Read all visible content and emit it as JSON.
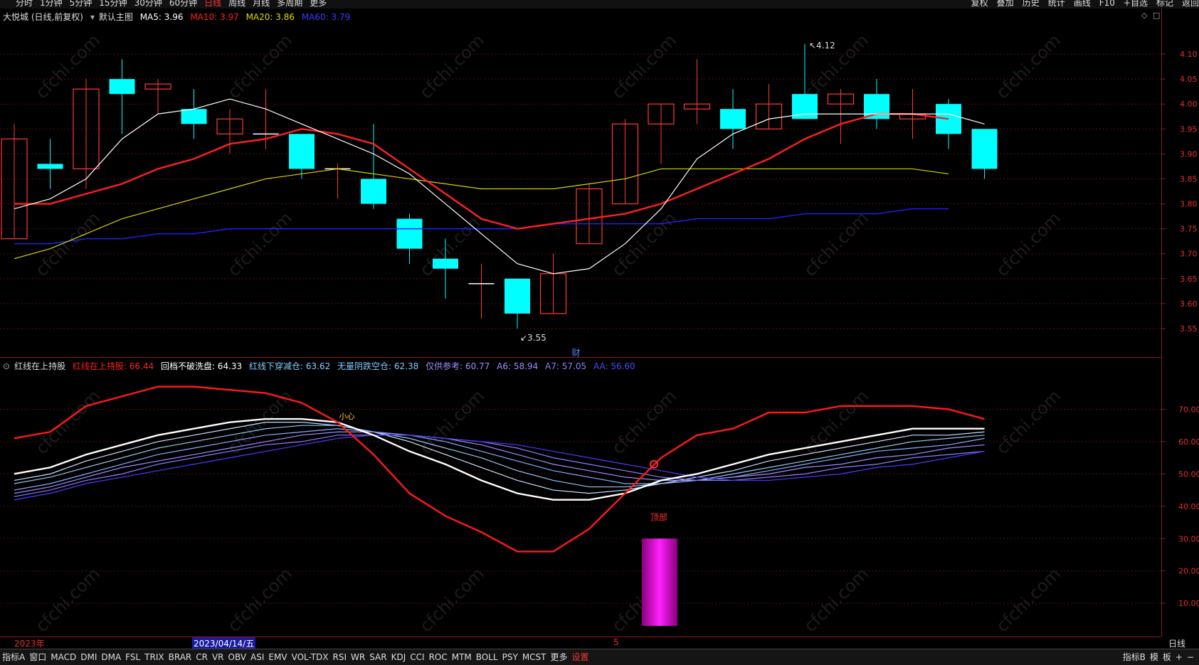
{
  "topbar": {
    "periods": [
      "分时",
      "1分钟",
      "5分钟",
      "15分钟",
      "30分钟",
      "60分钟",
      "日线",
      "周线",
      "月线",
      "多周期",
      "更多"
    ],
    "active_period": "日线",
    "right": [
      "复权",
      "叠加",
      "历史",
      "统计",
      "画线",
      "F10",
      "+自选",
      "标记",
      "返回"
    ]
  },
  "main": {
    "title": "大悦城 (日线,前复权)",
    "template": "默认主图",
    "ma5": "MA5: 3.96",
    "ma10": "MA10: 3.97",
    "ma20": "MA20: 3.86",
    "ma60": "MA60: 3.79",
    "high_label": "4.12",
    "low_label": "3.55",
    "marker": "财",
    "axis": [
      "4.10",
      "4.05",
      "4.00",
      "3.95",
      "3.90",
      "3.85",
      "3.80",
      "3.75",
      "3.70",
      "3.65",
      "3.60",
      "3.55"
    ]
  },
  "indicator": {
    "name": "红线在上持股",
    "v1": "红线在上持股: 66.44",
    "v2": "回档不破洗盘: 64.33",
    "v3": "红线下穿减仓: 63.62",
    "v4": "无量阴跌空仓: 62.38",
    "v5": "仅供参考: 60.77",
    "v6": "A6: 58.94",
    "v7": "A7: 57.05",
    "v8": "AA: 56.60",
    "signal_top": "顶部",
    "signal_small": "小心",
    "axis": [
      "70.00",
      "60.00",
      "50.00",
      "40.00",
      "30.00",
      "20.00",
      "10.00"
    ]
  },
  "dates": {
    "year": "2023年",
    "selected": "2023/04/14/五",
    "mark": "5",
    "period": "日线"
  },
  "bottombar": {
    "items": [
      "指标A",
      "窗口",
      "MACD",
      "DMI",
      "DMA",
      "FSL",
      "TRIX",
      "BRAR",
      "CR",
      "VR",
      "OBV",
      "ASI",
      "EMV",
      "VOL-TDX",
      "RSI",
      "WR",
      "SAR",
      "KDJ",
      "CCI",
      "ROC",
      "MTM",
      "BOLL",
      "PSY",
      "MCST",
      "更多",
      "设置"
    ],
    "highlight": "设置",
    "right": [
      "指标B",
      "模",
      "板",
      "+",
      "−"
    ]
  },
  "colors": {
    "up": "#ff3a3a",
    "down": "#00ffff",
    "ma5": "#ffffff",
    "ma10": "#ff2020",
    "ma20": "#d8d400",
    "ma60": "#2020ff",
    "watermark": "cfchi.com"
  },
  "chart_data": {
    "type": "candlestick",
    "ylim": [
      3.53,
      4.13
    ],
    "candles": [
      {
        "o": 3.73,
        "h": 3.96,
        "l": 3.73,
        "c": 3.93
      },
      {
        "o": 3.88,
        "h": 3.93,
        "l": 3.83,
        "c": 3.87
      },
      {
        "o": 3.87,
        "h": 4.05,
        "l": 3.83,
        "c": 4.03
      },
      {
        "o": 4.05,
        "h": 4.09,
        "l": 3.94,
        "c": 4.02
      },
      {
        "o": 4.03,
        "h": 4.05,
        "l": 3.98,
        "c": 4.04
      },
      {
        "o": 3.99,
        "h": 4.03,
        "l": 3.93,
        "c": 3.96
      },
      {
        "o": 3.94,
        "h": 3.99,
        "l": 3.9,
        "c": 3.97
      },
      {
        "o": 3.94,
        "h": 4.03,
        "l": 3.91,
        "c": 3.94
      },
      {
        "o": 3.94,
        "h": 3.94,
        "l": 3.85,
        "c": 3.87
      },
      {
        "o": 3.87,
        "h": 3.88,
        "l": 3.81,
        "c": 3.87
      },
      {
        "o": 3.85,
        "h": 3.96,
        "l": 3.79,
        "c": 3.8
      },
      {
        "o": 3.77,
        "h": 3.78,
        "l": 3.68,
        "c": 3.71
      },
      {
        "o": 3.69,
        "h": 3.73,
        "l": 3.61,
        "c": 3.67
      },
      {
        "o": 3.64,
        "h": 3.68,
        "l": 3.57,
        "c": 3.64
      },
      {
        "o": 3.65,
        "h": 3.65,
        "l": 3.55,
        "c": 3.58
      },
      {
        "o": 3.58,
        "h": 3.7,
        "l": 3.58,
        "c": 3.66
      },
      {
        "o": 3.72,
        "h": 3.84,
        "l": 3.72,
        "c": 3.83
      },
      {
        "o": 3.8,
        "h": 3.97,
        "l": 3.8,
        "c": 3.96
      },
      {
        "o": 3.96,
        "h": 4.0,
        "l": 3.88,
        "c": 4.0
      },
      {
        "o": 3.99,
        "h": 4.09,
        "l": 3.96,
        "c": 4.0
      },
      {
        "o": 3.99,
        "h": 4.03,
        "l": 3.91,
        "c": 3.95
      },
      {
        "o": 3.95,
        "h": 4.04,
        "l": 3.95,
        "c": 4.0
      },
      {
        "o": 4.02,
        "h": 4.12,
        "l": 3.97,
        "c": 3.97
      },
      {
        "o": 4.0,
        "h": 4.03,
        "l": 3.92,
        "c": 4.02
      },
      {
        "o": 4.02,
        "h": 4.05,
        "l": 3.95,
        "c": 3.97
      },
      {
        "o": 3.97,
        "h": 4.03,
        "l": 3.93,
        "c": 3.98
      },
      {
        "o": 4.0,
        "h": 4.01,
        "l": 3.91,
        "c": 3.94
      },
      {
        "o": 3.95,
        "h": 3.95,
        "l": 3.85,
        "c": 3.87
      }
    ],
    "ma5": [
      3.79,
      3.81,
      3.85,
      3.93,
      3.98,
      3.99,
      4.01,
      3.99,
      3.96,
      3.93,
      3.9,
      3.86,
      3.8,
      3.74,
      3.68,
      3.66,
      3.67,
      3.72,
      3.79,
      3.89,
      3.94,
      3.97,
      3.98,
      3.98,
      3.98,
      3.98,
      3.98,
      3.96
    ],
    "ma10": [
      3.8,
      3.8,
      3.82,
      3.84,
      3.87,
      3.89,
      3.92,
      3.93,
      3.95,
      3.94,
      3.92,
      3.87,
      3.82,
      3.77,
      3.75,
      3.76,
      3.77,
      3.78,
      3.8,
      3.83,
      3.86,
      3.89,
      3.93,
      3.96,
      3.98,
      3.98,
      3.97
    ],
    "ma20": [
      3.69,
      3.71,
      3.74,
      3.77,
      3.79,
      3.81,
      3.83,
      3.85,
      3.86,
      3.87,
      3.86,
      3.85,
      3.84,
      3.83,
      3.83,
      3.83,
      3.84,
      3.85,
      3.87,
      3.87,
      3.87,
      3.87,
      3.87,
      3.87,
      3.87,
      3.87,
      3.86
    ],
    "ma60": [
      3.72,
      3.72,
      3.73,
      3.73,
      3.74,
      3.74,
      3.75,
      3.75,
      3.75,
      3.75,
      3.75,
      3.75,
      3.75,
      3.75,
      3.75,
      3.76,
      3.76,
      3.76,
      3.76,
      3.77,
      3.77,
      3.77,
      3.78,
      3.78,
      3.78,
      3.79,
      3.79
    ],
    "indicator": {
      "ylim": [
        3,
        80
      ],
      "red": [
        61,
        63,
        71,
        74,
        77,
        77,
        76,
        75,
        72,
        66,
        56,
        44,
        37,
        32,
        26,
        26,
        33,
        44,
        55,
        62,
        64,
        69,
        69,
        71,
        71,
        71,
        70,
        67
      ],
      "white": [
        50,
        52,
        56,
        59,
        62,
        64,
        66,
        67,
        67,
        66,
        62,
        57,
        53,
        48,
        44,
        42,
        42,
        44,
        48,
        50,
        53,
        56,
        58,
        60,
        62,
        64,
        64,
        64
      ],
      "lines": [
        [
          48,
          50,
          54,
          57,
          60,
          62,
          64,
          66,
          66,
          65,
          63,
          60,
          56,
          52,
          48,
          45,
          44,
          45,
          47,
          49,
          51,
          54,
          56,
          58,
          60,
          62,
          62,
          63
        ],
        [
          47,
          49,
          52,
          55,
          58,
          60,
          62,
          64,
          65,
          65,
          63,
          61,
          58,
          55,
          51,
          48,
          46,
          46,
          47,
          48,
          50,
          52,
          54,
          56,
          58,
          60,
          61,
          62
        ],
        [
          45,
          47,
          50,
          53,
          56,
          58,
          60,
          62,
          63,
          64,
          63,
          62,
          60,
          57,
          54,
          51,
          49,
          47,
          47,
          48,
          49,
          51,
          53,
          55,
          57,
          58,
          59,
          61
        ],
        [
          44,
          46,
          49,
          52,
          54,
          56,
          58,
          60,
          62,
          63,
          63,
          62,
          61,
          59,
          56,
          53,
          51,
          49,
          48,
          48,
          49,
          50,
          52,
          53,
          55,
          56,
          58,
          59
        ],
        [
          43,
          45,
          48,
          50,
          53,
          55,
          57,
          59,
          60,
          62,
          62,
          62,
          61,
          60,
          58,
          55,
          53,
          51,
          49,
          48,
          48,
          49,
          50,
          52,
          53,
          55,
          56,
          57
        ],
        [
          42,
          44,
          47,
          49,
          51,
          53,
          55,
          57,
          59,
          61,
          62,
          62,
          61,
          60,
          59,
          57,
          55,
          53,
          51,
          49,
          48,
          48,
          49,
          50,
          52,
          53,
          55,
          57
        ]
      ],
      "bar": {
        "index": 18,
        "value": 30
      }
    }
  }
}
